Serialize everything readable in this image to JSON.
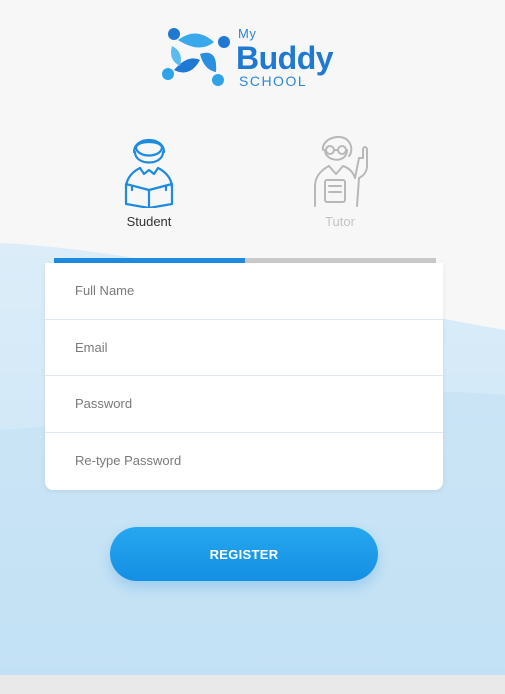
{
  "logo": {
    "line1": "My",
    "line2": "Buddy",
    "line3": "SCHOOL"
  },
  "roles": [
    {
      "label": "Student",
      "selected": true,
      "icon": "student-reading-icon"
    },
    {
      "label": "Tutor",
      "selected": false,
      "icon": "tutor-icon"
    }
  ],
  "role_tab_progress": 0.5,
  "form": {
    "fields": [
      {
        "placeholder": "Full Name",
        "value": ""
      },
      {
        "placeholder": "Email",
        "value": ""
      },
      {
        "placeholder": "Password",
        "value": ""
      },
      {
        "placeholder": "Re-type Password",
        "value": ""
      }
    ],
    "submit_label": "REGISTER"
  },
  "colors": {
    "accent": "#1d8be0",
    "brand_text": "#1f78d1",
    "inactive": "#c4c4c4"
  }
}
